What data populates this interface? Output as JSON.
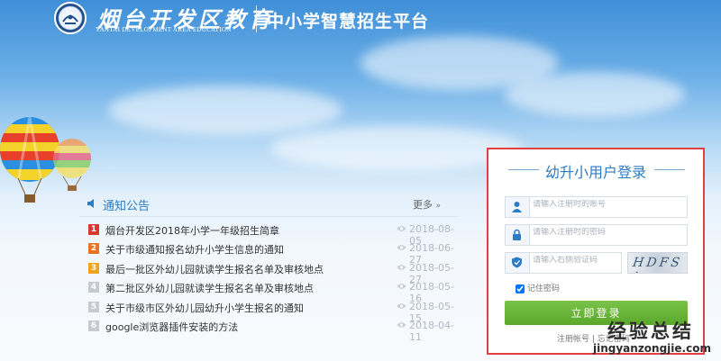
{
  "header": {
    "brand_cn": "烟台开发区教育",
    "brand_en": "YANTAI DEVELOPMENT AREA EDUCATION",
    "platform_title": "中小学智慧招生平台"
  },
  "notice": {
    "title": "通知公告",
    "more_label": "更多",
    "items": [
      {
        "num": "1",
        "title": "烟台开发区2018年小学一年级招生简章",
        "date": "2018-08-05",
        "color": "#d9392b"
      },
      {
        "num": "2",
        "title": "关于市级通知报名幼升小学生信息的通知",
        "date": "2018-06-27",
        "color": "#e8741f"
      },
      {
        "num": "3",
        "title": "最后一批区外幼儿园就读学生报名名单及审核地点",
        "date": "2018-05-27",
        "color": "#f0a31e"
      },
      {
        "num": "4",
        "title": "第二批区外幼儿园就读学生报名名单及审核地点",
        "date": "2018-05-16",
        "color": "#c5cbd1"
      },
      {
        "num": "5",
        "title": "关于市级市区外幼儿园幼升小学生报名的通知",
        "date": "2018-05-15",
        "color": "#c5cbd1"
      },
      {
        "num": "6",
        "title": "google浏览器插件安装的方法",
        "date": "2018-04-11",
        "color": "#c5cbd1"
      }
    ]
  },
  "login": {
    "title": "幼升小用户登录",
    "username_placeholder": "请输入注册时的账号",
    "password_placeholder": "请输入注册时的密码",
    "captcha_placeholder": "请输入右侧验证码",
    "captcha_text": "HDFS A",
    "remember_label": "记住密码",
    "remember_checked": true,
    "login_button": "立即登录",
    "register_label": "注册帐号 | 忘记密码"
  },
  "watermark": {
    "cn": "经验总结",
    "en": "jingyanzongjie.com"
  },
  "colors": {
    "accent_blue": "#2b7cc6",
    "login_green": "#6ab83a",
    "highlight_red": "#e14040"
  }
}
